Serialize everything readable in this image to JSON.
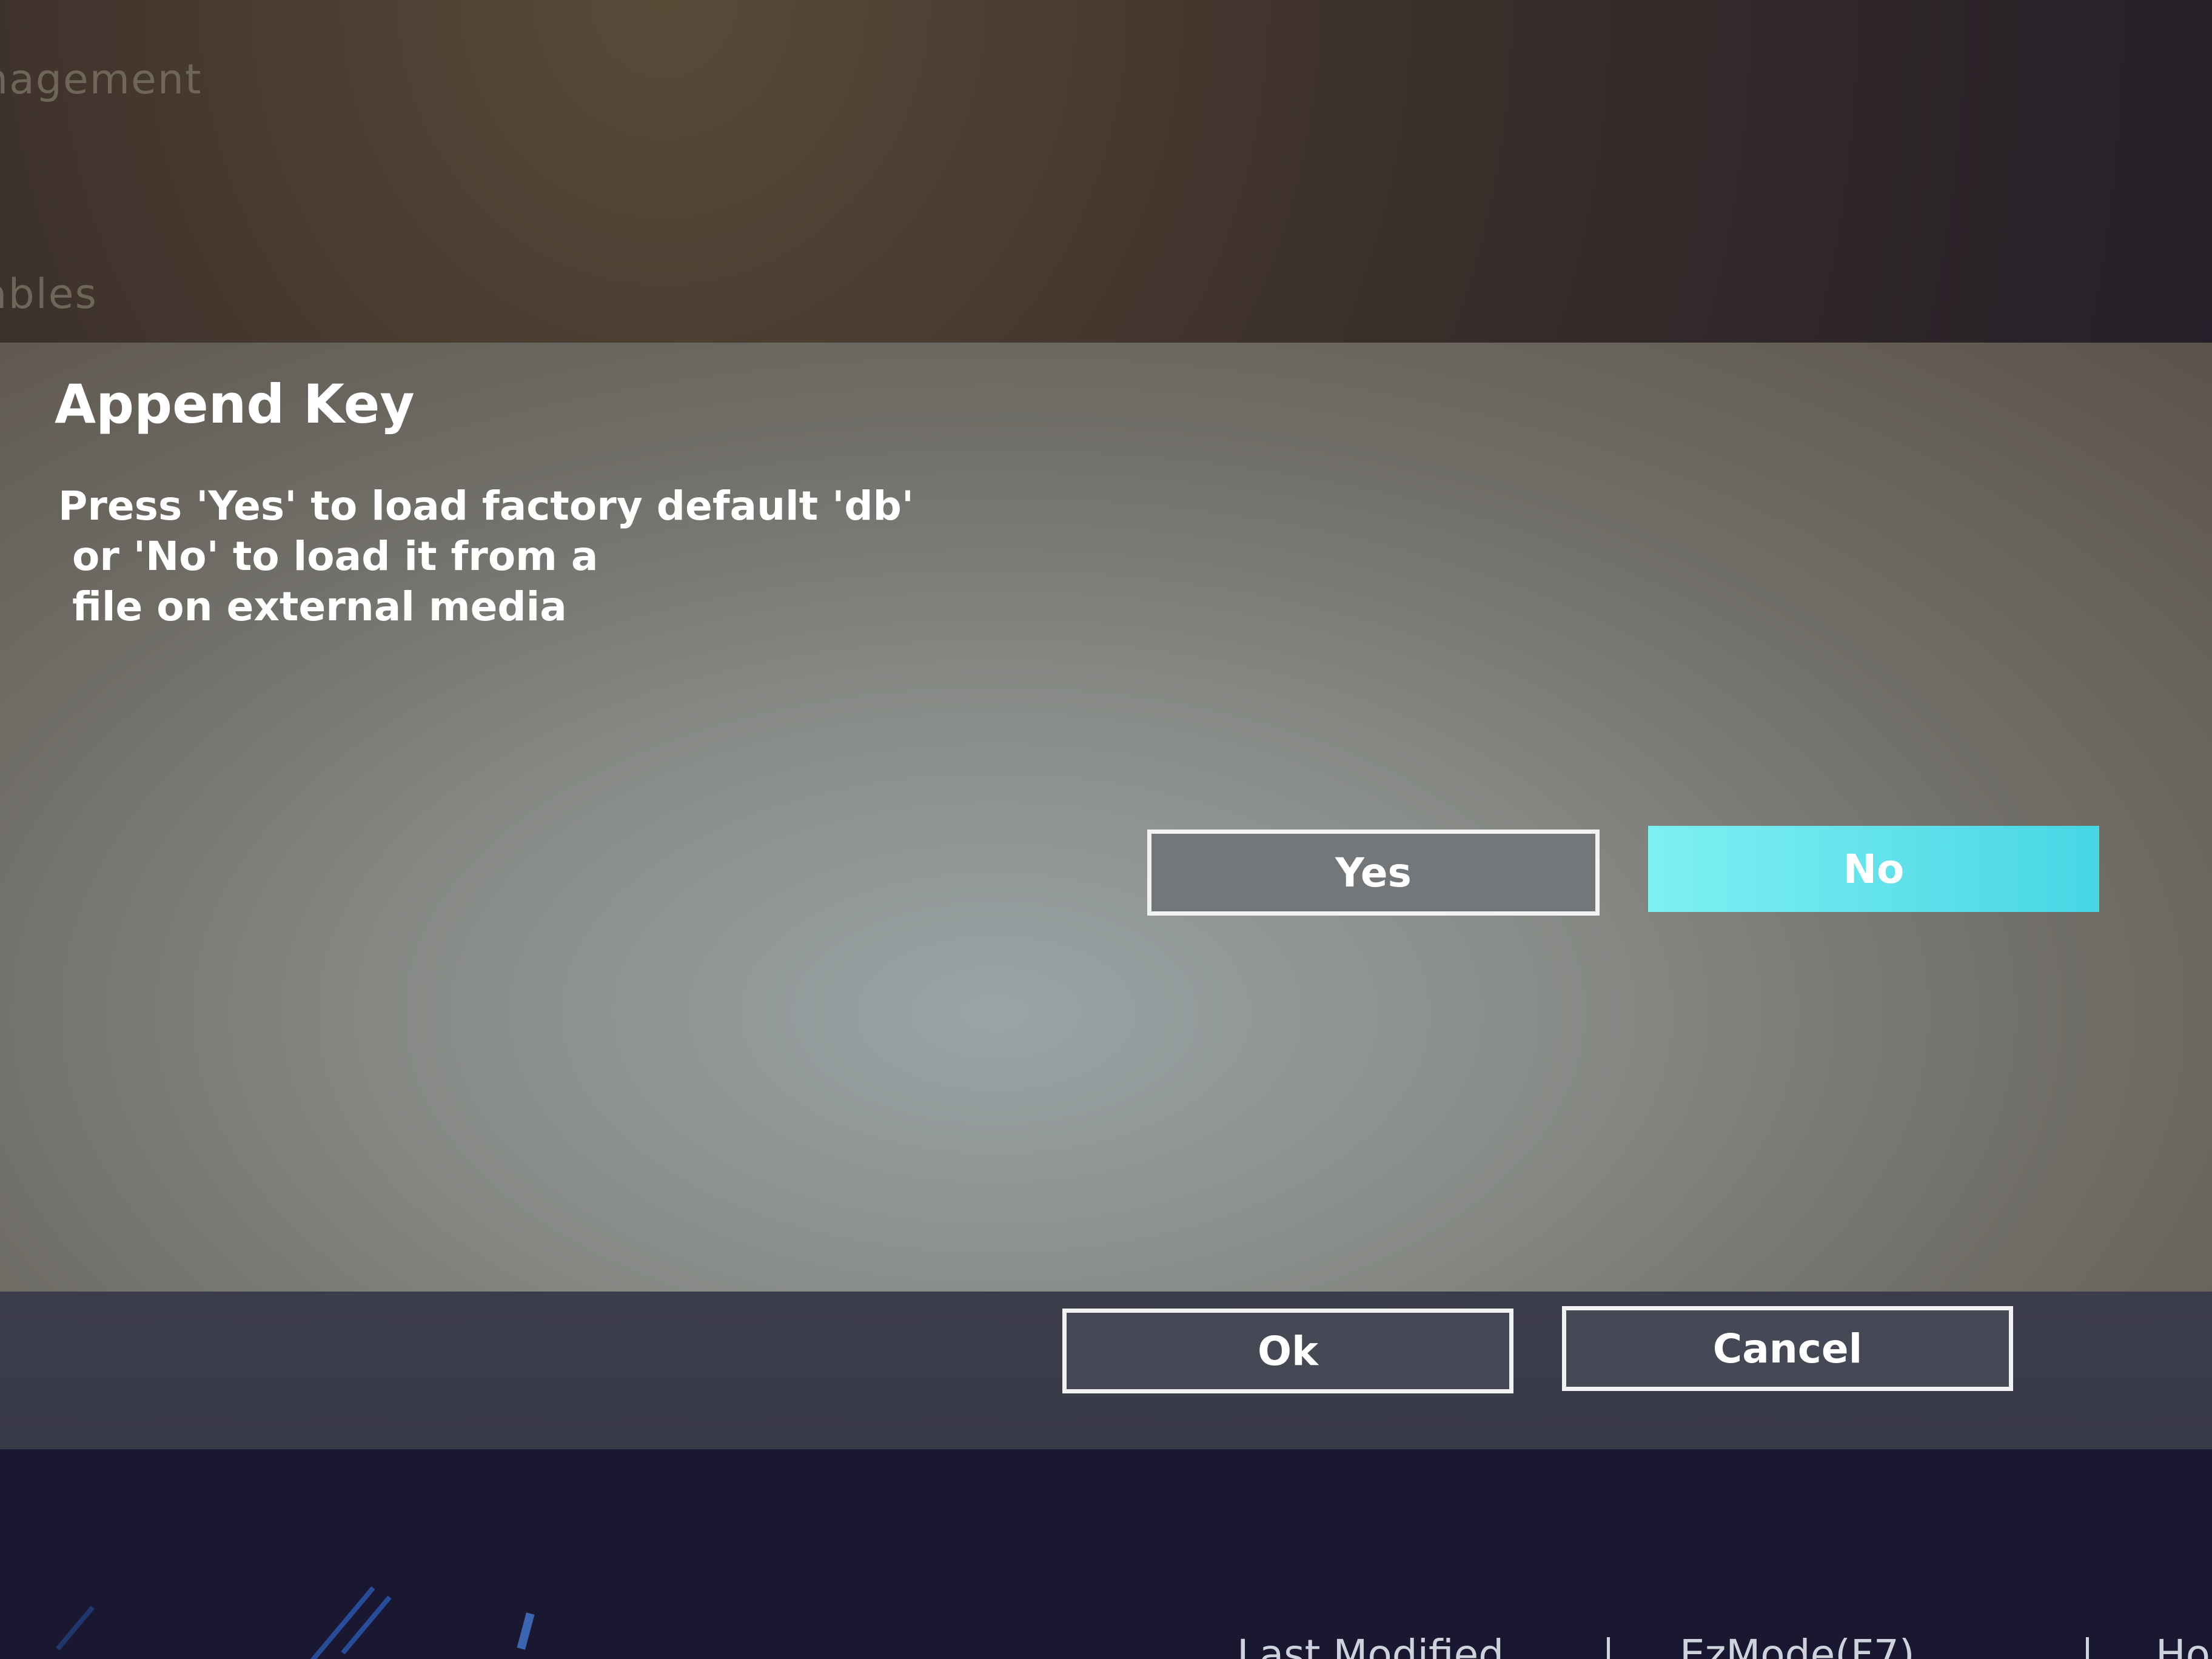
{
  "background": {
    "labels": [
      "nagement",
      "ables"
    ]
  },
  "dialog": {
    "title": "Append Key",
    "message": "Press 'Yes' to load factory default 'db'\n or 'No' to load it from a\n file on external media",
    "yes_label": "Yes",
    "no_label": "No",
    "selected_button": "No"
  },
  "footer": {
    "ok_label": "Ok",
    "cancel_label": "Cancel"
  },
  "status_bar": {
    "last_modified": "Last Modified",
    "ezmode": "EzMode(F7)",
    "hotkeys": "Ho"
  },
  "colors": {
    "selected_button": "#5ee0ea",
    "dialog_text": "#ffffff"
  }
}
